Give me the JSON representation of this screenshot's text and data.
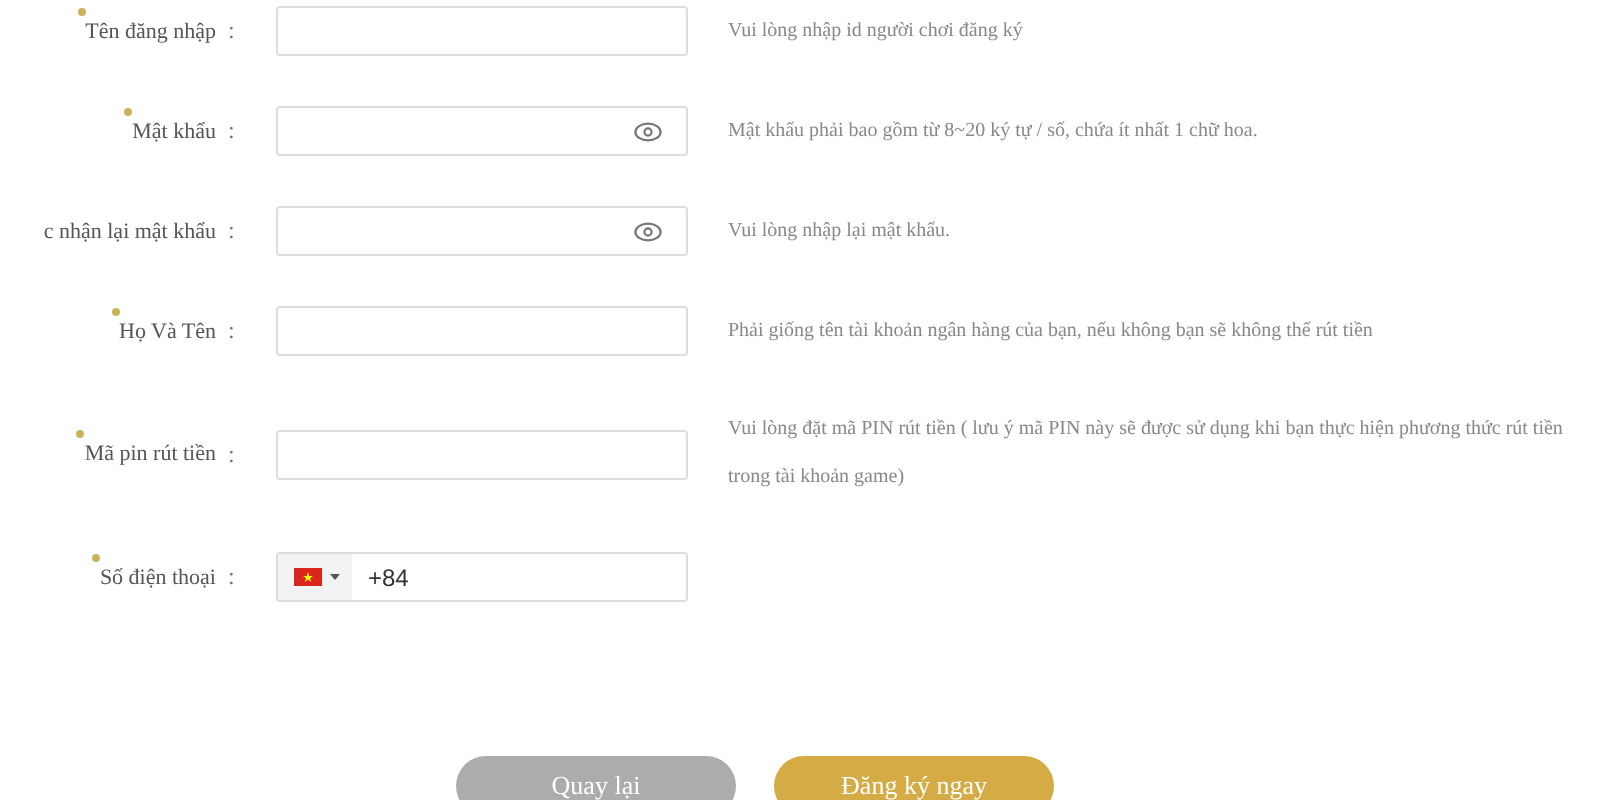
{
  "fields": [
    {
      "label": "Tên đăng nhập",
      "required": true,
      "kind": "text",
      "hint": "Vui lòng nhập id người chơi đăng ký"
    },
    {
      "label": "Mật khẩu",
      "required": true,
      "kind": "password",
      "hint": "Mật khẩu phải bao gồm từ 8~20 ký tự / số, chứa ít nhất 1 chữ hoa."
    },
    {
      "label": "c nhận lại mật khẩu",
      "required": false,
      "kind": "password",
      "hint": "Vui lòng nhập lại mật khẩu."
    },
    {
      "label": "Họ Và Tên",
      "required": true,
      "kind": "text",
      "hint": "Phải giống tên tài khoản ngân hàng của bạn, nếu không bạn sẽ không thể rút tiền"
    },
    {
      "label": "Mã pin rút tiền",
      "required": true,
      "kind": "text",
      "hint": "Vui lòng đặt mã PIN rút tiền ( lưu ý mã PIN này sẽ được sử dụng khi bạn thực hiện phương thức rút tiền trong tài khoản game)"
    },
    {
      "label": "Số điện thoại",
      "required": true,
      "kind": "phone",
      "value": "+84"
    }
  ],
  "separator": ":",
  "buttons": [
    {
      "label": "Quay lại",
      "kind": "secondary"
    },
    {
      "label": "Đăng ký ngay",
      "kind": "primary"
    }
  ]
}
